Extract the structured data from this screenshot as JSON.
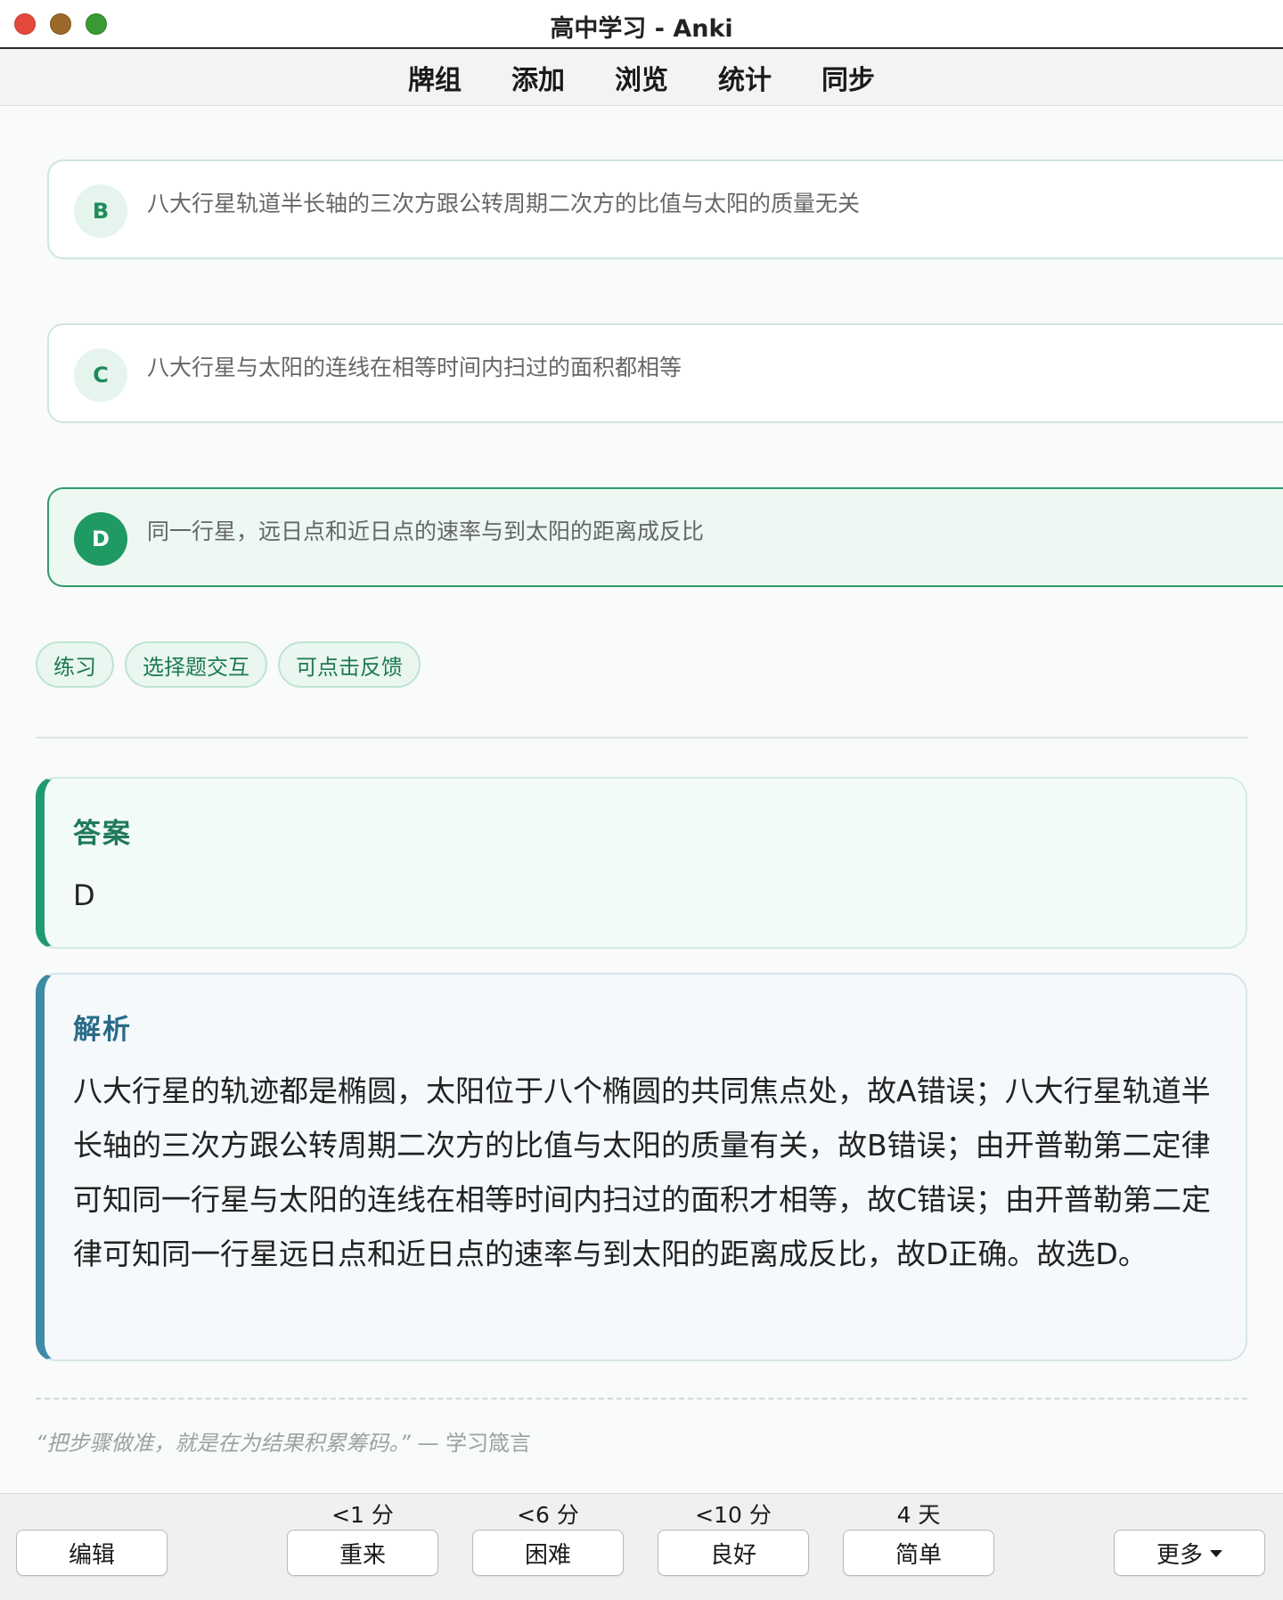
{
  "window": {
    "title": "高中学习 - Anki"
  },
  "menu": {
    "decks": "牌组",
    "add": "添加",
    "browse": "浏览",
    "stats": "统计",
    "sync": "同步"
  },
  "options": [
    {
      "letter": "B",
      "text": "八大行星轨道半长轴的三次方跟公转周期二次方的比值与太阳的质量无关",
      "selected": false
    },
    {
      "letter": "C",
      "text": "八大行星与太阳的连线在相等时间内扫过的面积都相等",
      "selected": false
    },
    {
      "letter": "D",
      "text": "同一行星，远日点和近日点的速率与到太阳的距离成反比",
      "selected": true
    }
  ],
  "tags": [
    "练习",
    "选择题交互",
    "可点击反馈"
  ],
  "answer": {
    "title": "答案",
    "value": "D"
  },
  "analysis": {
    "title": "解析",
    "text": "八大行星的轨迹都是椭圆，太阳位于八个椭圆的共同焦点处，故A错误；八大行星轨道半长轴的三次方跟公转周期二次方的比值与太阳的质量有关，故B错误；由开普勒第二定律可知同一行星与太阳的连线在相等时间内扫过的面积才相等，故C错误；由开普勒第二定律可知同一行星远日点和近日点的速率与到太阳的距离成反比，故D正确。故选D。"
  },
  "quote": {
    "text": "“把步骤做准，就是在为结果积累筹码。”",
    "source": "— 学习箴言"
  },
  "bottom": {
    "edit": "编辑",
    "again": {
      "label": "重来",
      "interval": "<1 分"
    },
    "hard": {
      "label": "困难",
      "interval": "<6 分"
    },
    "good": {
      "label": "良好",
      "interval": "<10 分"
    },
    "easy": {
      "label": "简单",
      "interval": "4 天"
    },
    "more": "更多"
  },
  "colors": {
    "accent_green": "#1f9a63",
    "analysis_blue": "#3f8aa5"
  }
}
